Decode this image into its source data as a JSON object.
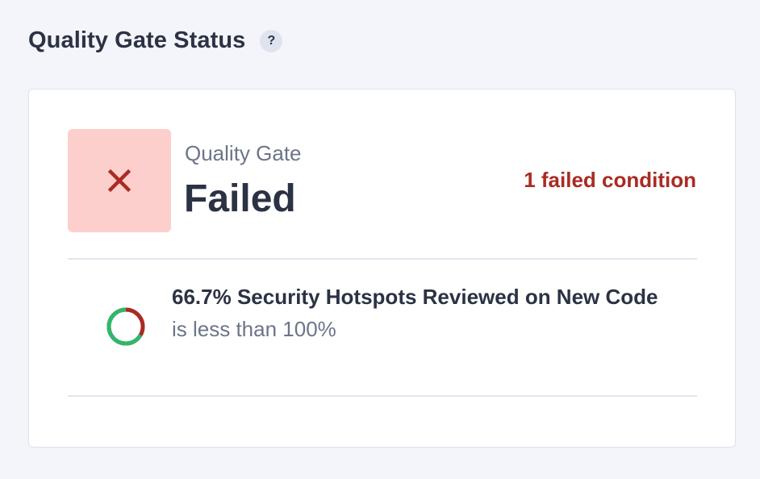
{
  "header": {
    "title": "Quality Gate Status",
    "help_icon": "question-mark-icon",
    "help_glyph": "?"
  },
  "gate": {
    "label": "Quality Gate",
    "status": "Failed",
    "status_icon": "close-icon",
    "failed_conditions": "1 failed condition"
  },
  "conditions": [
    {
      "metric": "66.7% Security Hotspots Reviewed on New Code",
      "threshold": "is less than 100%",
      "reviewed_percent": 66.7
    }
  ],
  "colors": {
    "error": "#a92b23",
    "error_background": "#fccfcc",
    "success": "#2fb86b"
  }
}
